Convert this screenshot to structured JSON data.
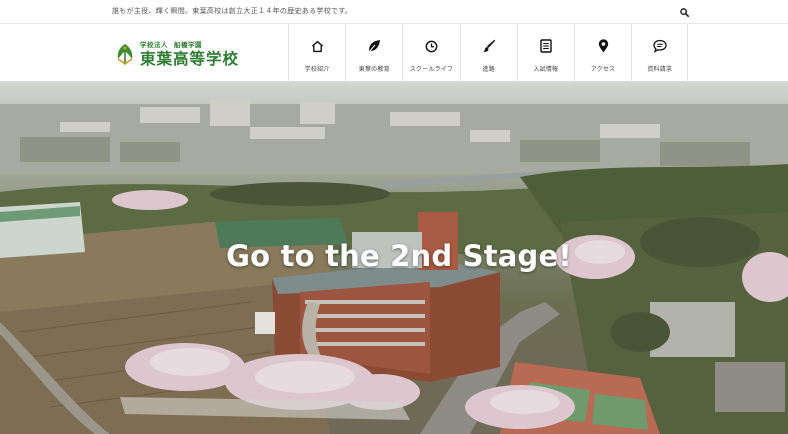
{
  "topbar": {
    "notice": "誰もが主役、輝く瞬間。東葉高校は創立大正１４年の歴史ある学校です。",
    "search_icon": "search-icon"
  },
  "brand": {
    "corporation": "学校法人",
    "foundation": "船橋学園",
    "school_name": "東葉高等学校",
    "color": "#2e7d32"
  },
  "nav": {
    "items": [
      {
        "label": "学校紹介",
        "icon": "home-icon"
      },
      {
        "label": "東葉の教育",
        "icon": "leaf-icon"
      },
      {
        "label": "スクールライフ",
        "icon": "clock-icon"
      },
      {
        "label": "進路",
        "icon": "brush-icon"
      },
      {
        "label": "入試情報",
        "icon": "document-icon"
      },
      {
        "label": "アクセス",
        "icon": "map-pin-icon"
      },
      {
        "label": "資料請求",
        "icon": "chat-icon"
      }
    ]
  },
  "hero": {
    "headline": "Go to the 2nd Stage!"
  }
}
